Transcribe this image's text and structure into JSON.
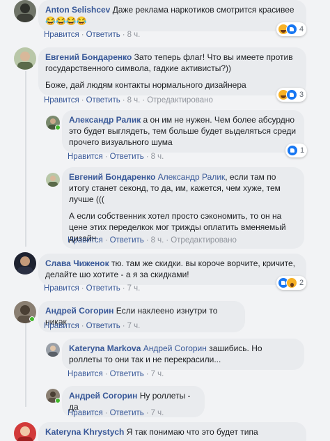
{
  "actions": {
    "like": "Нравится",
    "reply": "Ответить",
    "edited": "Отредактировано"
  },
  "comments": [
    {
      "author": "Anton Selishcev",
      "text": "Даже реклама наркотиков смотрится красивее 😂😂😂😂",
      "time": "8 ч.",
      "reactions": {
        "icons": [
          "haha-icon",
          "like-icon"
        ],
        "count": "4"
      }
    },
    {
      "author": "Евгений Бондаренко",
      "text": "Зато теперь флаг! Что вы имеете против государственного символа, гадкие активисты?))",
      "text2": "Боже, дай людям контакты нормального дизайнера",
      "time": "8 ч.",
      "edited": true,
      "reactions": {
        "icons": [
          "haha-icon",
          "like-icon"
        ],
        "count": "3"
      }
    },
    {
      "author": "Александр Ралик",
      "text": "а он им не нужен. Чем более абсурдно это будет выглядеть, тем больше будет выделяться среди прочего визуального шума",
      "time": "8 ч.",
      "reactions": {
        "icons": [
          "like-icon"
        ],
        "count": "1"
      }
    },
    {
      "author": "Евгений Бондаренко",
      "mention": "Александр Ралик",
      "text": ", если там по итогу станет секонд, то да, им, кажется, чем хуже, тем лучше (((",
      "text2": "А если собственник хотел просто сэкономить, то он на цене этих переделкок мог трижды оплатить вменяемый дизайн",
      "time": "8 ч.",
      "edited": true
    },
    {
      "author": "Слава Чиженок",
      "text": "тю. там же скидки. вы короче ворчите, кричите, делайте шо хотите - а я за скидками!",
      "time": "7 ч.",
      "reactions": {
        "icons": [
          "like-icon",
          "wow-icon"
        ],
        "count": "2"
      }
    },
    {
      "author": "Андрей Согорин",
      "text": "Если наклеено изнутри то никак",
      "time": "7 ч."
    },
    {
      "author": "Kateryna Markova",
      "mention": "Андрей Согорин",
      "text": " зашибись. Но роллеты то они так и не перекрасили...",
      "time": "7 ч."
    },
    {
      "author": "Андрей Согорин",
      "text": "Ну роллеты - да",
      "time": "7 ч."
    },
    {
      "author": "Kateryna Khrystych",
      "text": "Я так понимаю что это будет типа"
    }
  ]
}
